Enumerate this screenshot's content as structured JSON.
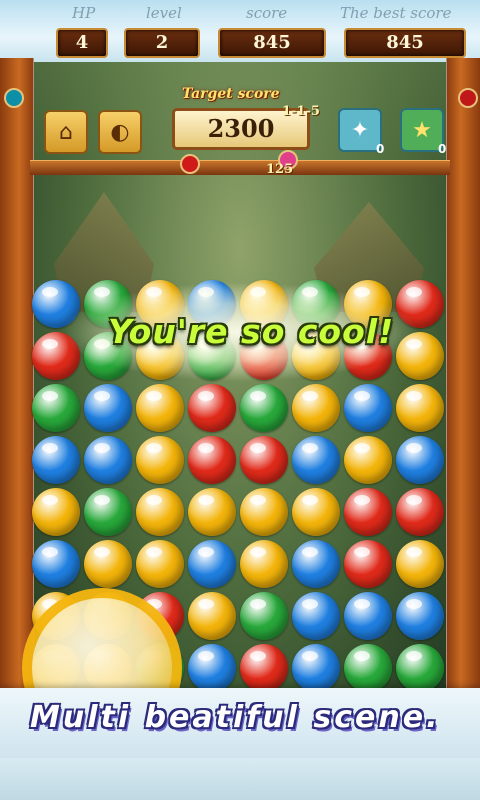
{
  "header": {
    "labels": [
      "HP",
      "level",
      "score",
      "The best score"
    ],
    "values": [
      "4",
      "2",
      "845",
      "845"
    ]
  },
  "controls": {
    "home_icon": "home-icon",
    "sound_icon": "speaker-icon"
  },
  "target": {
    "label": "Target score",
    "value": "2300",
    "level_code": "1-1-5"
  },
  "powerups": [
    {
      "icon": "bomb-card-icon",
      "count": "0",
      "color": "#5fb8c9"
    },
    {
      "icon": "star-card-icon",
      "count": "0",
      "color": "#4fae57"
    }
  ],
  "rail_count": "125",
  "message": "You're so cool!",
  "promo": "Multi beatiful scene.",
  "colors": {
    "red": "#e02a1a",
    "green": "#28a83a",
    "blue": "#1f7fe0",
    "yellow": "#f3b40a"
  },
  "board": [
    [
      "blue",
      "green",
      "yellow",
      "blue",
      "yellow",
      "green",
      "yellow",
      "red"
    ],
    [
      "red",
      "green",
      "yellow",
      "green",
      "red",
      "yellow",
      "red",
      "yellow"
    ],
    [
      "green",
      "blue",
      "yellow",
      "red",
      "green",
      "yellow",
      "blue",
      "yellow"
    ],
    [
      "blue",
      "blue",
      "yellow",
      "red",
      "red",
      "blue",
      "yellow",
      "blue"
    ],
    [
      "yellow",
      "green",
      "yellow",
      "yellow",
      "yellow",
      "yellow",
      "red",
      "red"
    ],
    [
      "blue",
      "yellow",
      "yellow",
      "blue",
      "yellow",
      "blue",
      "red",
      "yellow"
    ],
    [
      "yellow",
      "yellow",
      "red",
      "yellow",
      "green",
      "blue",
      "blue",
      "blue"
    ],
    [
      "yellow",
      "yellow",
      "green",
      "blue",
      "red",
      "blue",
      "green",
      "green"
    ]
  ]
}
